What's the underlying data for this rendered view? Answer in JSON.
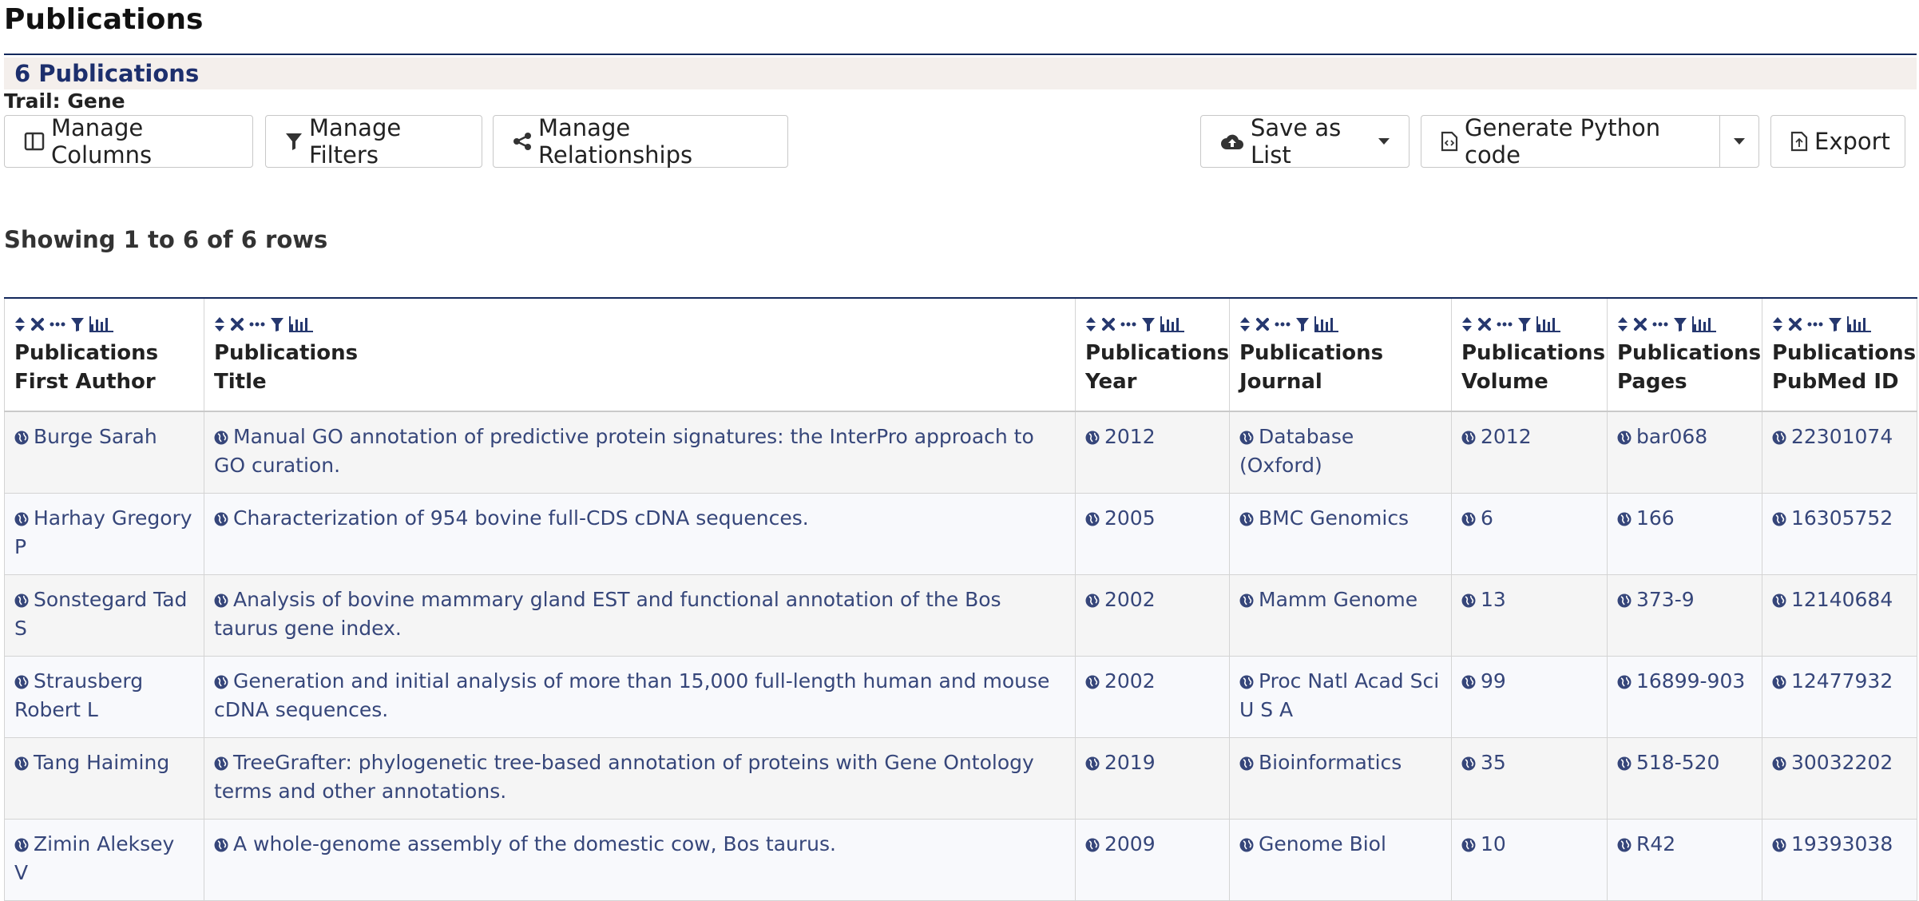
{
  "page": {
    "title": "Publications"
  },
  "summary": {
    "count_label": "6 Publications",
    "trail": "Trail: Gene"
  },
  "toolbar": {
    "manage_columns": "Manage Columns",
    "manage_filters": "Manage Filters",
    "manage_relationships": "Manage Relationships",
    "save_as_list": "Save as List",
    "generate_python": "Generate Python code",
    "export": "Export"
  },
  "status": {
    "showing": "Showing 1 to 6 of 6 rows"
  },
  "table": {
    "columns": [
      {
        "line1": "Publications",
        "line2": "First Author"
      },
      {
        "line1": "Publications",
        "line2": "Title"
      },
      {
        "line1": "Publications",
        "line2": "Year"
      },
      {
        "line1": "Publications",
        "line2": "Journal"
      },
      {
        "line1": "Publications",
        "line2": "Volume"
      },
      {
        "line1": "Publications",
        "line2": "Pages"
      },
      {
        "line1": "Publications",
        "line2": "PubMed ID"
      }
    ],
    "rows": [
      [
        "Burge Sarah",
        "Manual GO annotation of predictive protein signatures: the InterPro approach to GO curation.",
        "2012",
        "Database (Oxford)",
        "2012",
        "bar068",
        "22301074"
      ],
      [
        "Harhay Gregory P",
        "Characterization of 954 bovine full-CDS cDNA sequences.",
        "2005",
        "BMC Genomics",
        "6",
        "166",
        "16305752"
      ],
      [
        "Sonstegard Tad S",
        "Analysis of bovine mammary gland EST and functional annotation of the Bos taurus gene index.",
        "2002",
        "Mamm Genome",
        "13",
        "373-9",
        "12140684"
      ],
      [
        "Strausberg Robert L",
        "Generation and initial analysis of more than 15,000 full-length human and mouse cDNA sequences.",
        "2002",
        "Proc Natl Acad Sci U S A",
        "99",
        "16899-903",
        "12477932"
      ],
      [
        "Tang Haiming",
        "TreeGrafter: phylogenetic tree-based annotation of proteins with Gene Ontology terms and other annotations.",
        "2019",
        "Bioinformatics",
        "35",
        "518-520",
        "30032202"
      ],
      [
        "Zimin Aleksey V",
        "A whole-genome assembly of the domestic cow, Bos taurus.",
        "2009",
        "Genome Biol",
        "10",
        "R42",
        "19393038"
      ]
    ]
  },
  "icons": {
    "column_tools": [
      "sort-icon",
      "remove-column-icon",
      "more-icon",
      "filter-icon",
      "summary-chart-icon"
    ],
    "cell": "globe-icon"
  },
  "colors": {
    "accent": "#13285c",
    "link": "#36467a",
    "count_bar_bg": "#f4efec"
  }
}
